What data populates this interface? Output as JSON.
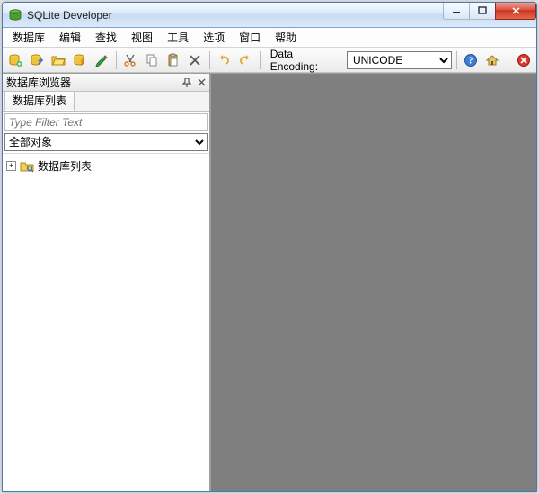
{
  "window": {
    "title": "SQLite Developer"
  },
  "menu": {
    "items": [
      "数据库",
      "编辑",
      "查找",
      "视图",
      "工具",
      "选项",
      "窗口",
      "帮助"
    ]
  },
  "toolbar": {
    "encoding_label": "Data Encoding:",
    "encoding_value": "UNICODE"
  },
  "sidebar": {
    "panel_title": "数据库浏览器",
    "tab_label": "数据库列表",
    "filter_placeholder": "Type Filter Text",
    "filter_select_value": "全部对象",
    "tree_root_label": "数据库列表"
  }
}
